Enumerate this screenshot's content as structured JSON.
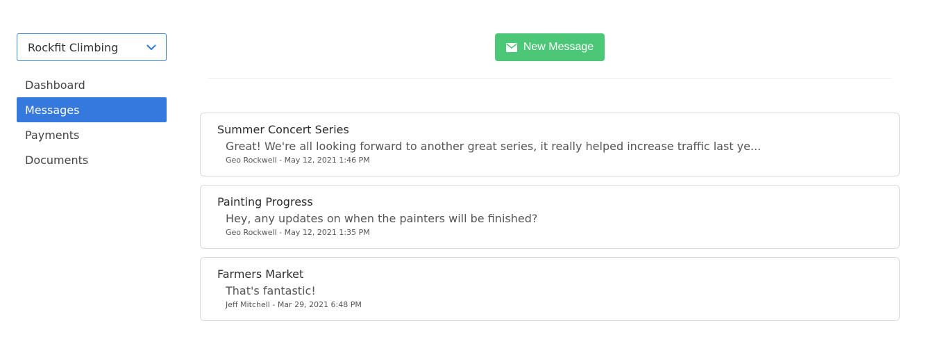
{
  "sidebar": {
    "org_selector": {
      "value": "Rockfit Climbing",
      "icon": "chevron-down-icon"
    },
    "nav": [
      {
        "label": "Dashboard",
        "active": false
      },
      {
        "label": "Messages",
        "active": true
      },
      {
        "label": "Payments",
        "active": false
      },
      {
        "label": "Documents",
        "active": false
      }
    ]
  },
  "toolbar": {
    "new_message_label": "New Message",
    "new_message_icon": "envelope-icon",
    "button_color": "#4cc778"
  },
  "messages": [
    {
      "title": "Summer Concert Series",
      "preview": "Great! We're all looking forward to another great series, it really helped increase traffic last ye...",
      "author": "Geo Rockwell",
      "timestamp": "May 12, 2021 1:46 PM"
    },
    {
      "title": "Painting Progress",
      "preview": "Hey, any updates on when the painters will be finished?",
      "author": "Geo Rockwell",
      "timestamp": "May 12, 2021 1:35 PM"
    },
    {
      "title": "Farmers Market",
      "preview": "That's fantastic!",
      "author": "Jeff Mitchell",
      "timestamp": "Mar 29, 2021 6:48 PM"
    }
  ],
  "colors": {
    "accent": "#3578de",
    "success": "#4cc778"
  }
}
